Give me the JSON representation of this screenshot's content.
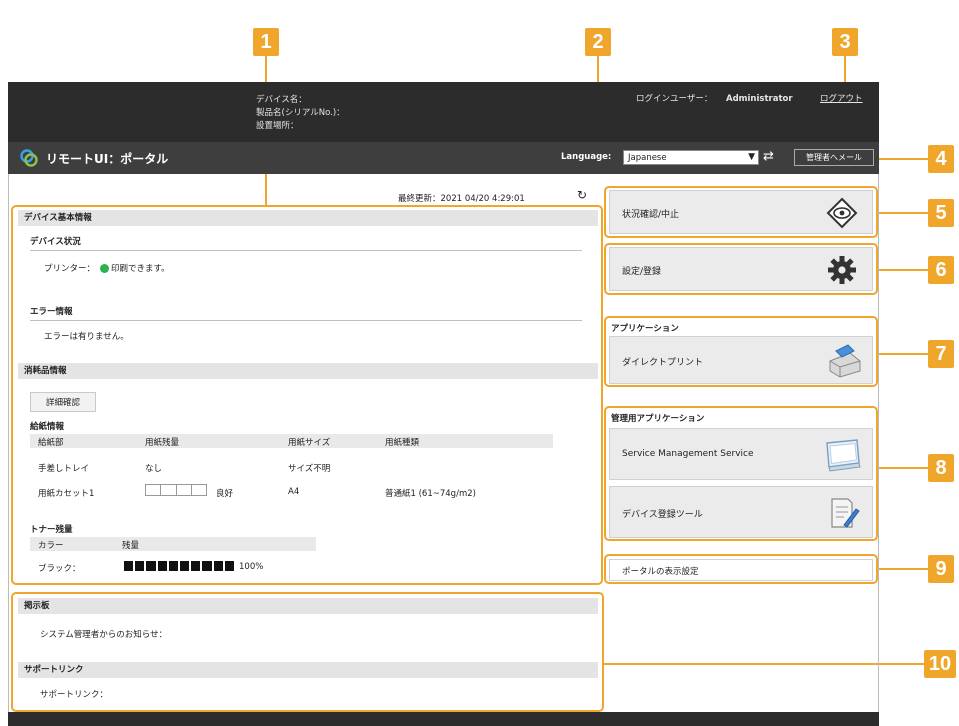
{
  "callouts": [
    "1",
    "2",
    "3",
    "4",
    "5",
    "6",
    "7",
    "8",
    "9",
    "10"
  ],
  "header": {
    "device_name": "デバイス名：",
    "product_name": "製品名(シリアルNo.)：",
    "location": "設置場所：",
    "login_user_label": "ログインユーザー：",
    "login_user": "Administrator",
    "logout": "ログアウト"
  },
  "titlebar": {
    "title": "リモートUI：ポータル",
    "language_label": "Language:",
    "language_value": "Japanese",
    "mail_button": "管理者へメール"
  },
  "main": {
    "last_updated": "最終更新：2021 04/20 4:29:01",
    "device_basic_info": "デバイス基本情報",
    "device_status": "デバイス状況",
    "printer_label": "プリンター：",
    "printer_status": "印刷できます。",
    "error_info": "エラー情報",
    "error_text": "エラーは有りません。",
    "consumables": "消耗品情報",
    "detail_button": "詳細確認",
    "paper_info": "給紙情報",
    "paper_headers": [
      "給紙部",
      "用紙残量",
      "用紙サイズ",
      "用紙種類"
    ],
    "paper_rows": [
      [
        "手差しトレイ",
        "なし",
        "サイズ不明",
        ""
      ],
      [
        "用紙カセット1",
        "良好",
        "A4",
        "普通紙1 (61~74g/m2)"
      ]
    ],
    "toner_title": "トナー残量",
    "toner_headers": [
      "カラー",
      "残量"
    ],
    "toner_color": "ブラック：",
    "toner_percent": "100%",
    "toner_level": 1.0
  },
  "board": {
    "title": "掲示板",
    "notice": "システム管理者からのお知らせ：",
    "support_title": "サポートリンク",
    "support_label": "サポートリンク："
  },
  "right": {
    "status_button": "状況確認/中止",
    "settings_button": "設定/登録",
    "apps_title": "アプリケーション",
    "direct_print": "ダイレクトプリント",
    "admin_apps_title": "管理用アプリケーション",
    "sms": "Service Management Service",
    "device_tool": "デバイス登録ツール",
    "portal_display": "ポータルの表示設定"
  },
  "colors": {
    "callout": "#f0a52b",
    "status_ok": "#2bb24c",
    "header": "#2c2c2c"
  }
}
